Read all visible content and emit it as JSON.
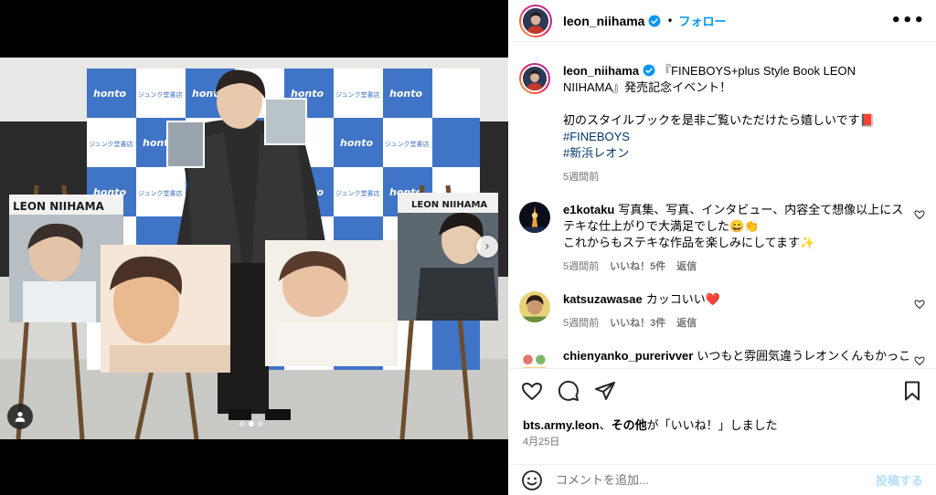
{
  "post": {
    "author": "leon_niihama",
    "follow_label": "フォロー",
    "bullet": "•",
    "more_label": "•••",
    "caption": "『FINEBOYS+plus Style Book LEON NIIHAMA』発売記念イベント！\n\n初のスタイルブックを是非ご覧いただけたら嬉しいです📕",
    "hashtags": [
      "#FINEBOYS",
      "#新浜レオン"
    ],
    "caption_time": "5週間前"
  },
  "photo": {
    "left_board_title": "LEON NIIHAMA",
    "right_board_title": "LEON NIIHAMA",
    "store_banner": "ジュンク堂書店",
    "brand_banner": "honto",
    "next_glyph": "›",
    "carousel_active_index": 1,
    "carousel_count": 3
  },
  "comments": [
    {
      "user": "e1kotaku",
      "text": "写真集、写真、インタビュー、内容全て想像以上にステキな仕上がりで大満足でした😄👏\nこれからもステキな作品を楽しみにしてます✨",
      "time": "5週間前",
      "likes": "いいね！5件",
      "reply": "返信"
    },
    {
      "user": "katsuzawasae",
      "text": "カッコいい❤️",
      "time": "5週間前",
      "likes": "いいね！3件",
      "reply": "返信"
    },
    {
      "user": "chienyanko_purerivver",
      "text": "いつもと雰囲気違うレオンくんもかっこ"
    }
  ],
  "likes_line": {
    "user": "bts.army.leon",
    "others": "その他",
    "suffix": "が「いいね！」しました"
  },
  "date": "4月25日",
  "composer": {
    "placeholder": "コメントを追加...",
    "post_label": "投稿する"
  },
  "colors": {
    "accent": "#0095f6",
    "muted": "#737373",
    "hashtag": "#00376b",
    "banner_blue": "#3f74c6",
    "heart_red": "#ed4956"
  }
}
